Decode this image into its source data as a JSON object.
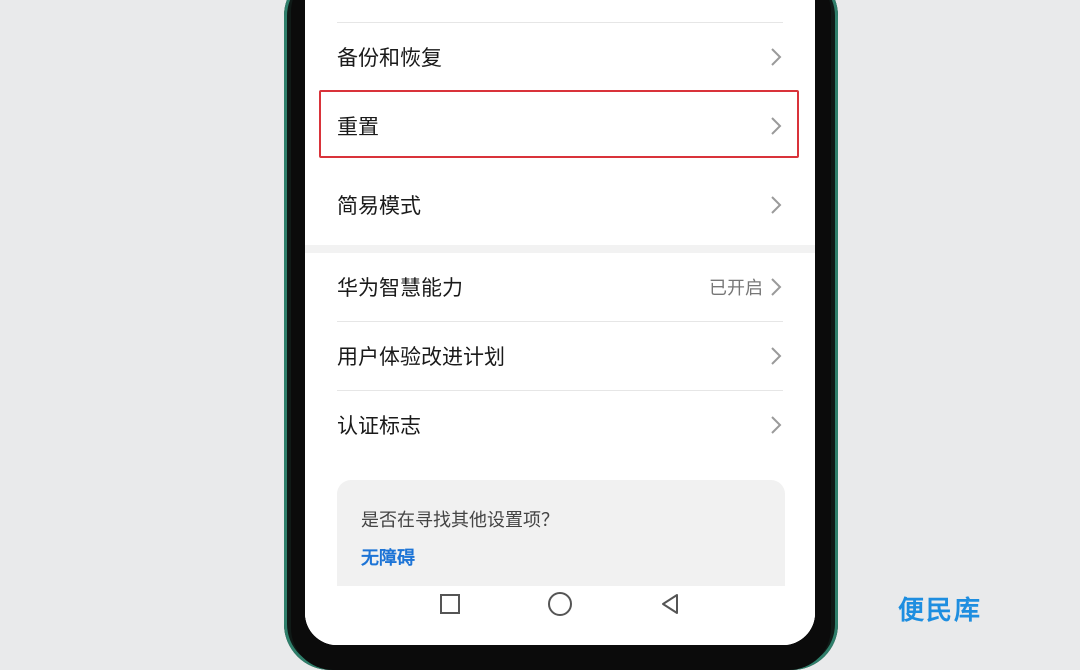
{
  "settings": {
    "items": [
      {
        "label": "备份和恢复",
        "status": ""
      },
      {
        "label": "重置",
        "status": ""
      },
      {
        "label": "简易模式",
        "status": ""
      },
      {
        "label": "华为智慧能力",
        "status": "已开启"
      },
      {
        "label": "用户体验改进计划",
        "status": ""
      },
      {
        "label": "认证标志",
        "status": ""
      }
    ]
  },
  "tip": {
    "question": "是否在寻找其他设置项？",
    "link": "无障碍"
  },
  "watermark": "便民库",
  "colors": {
    "highlight": "#d9333a",
    "link": "#1d74d6",
    "watermark": "#1e8ee0",
    "frame": "#2f7f6b"
  },
  "icons": [
    "chevron-right-icon",
    "square-icon",
    "circle-icon",
    "triangle-back-icon"
  ]
}
